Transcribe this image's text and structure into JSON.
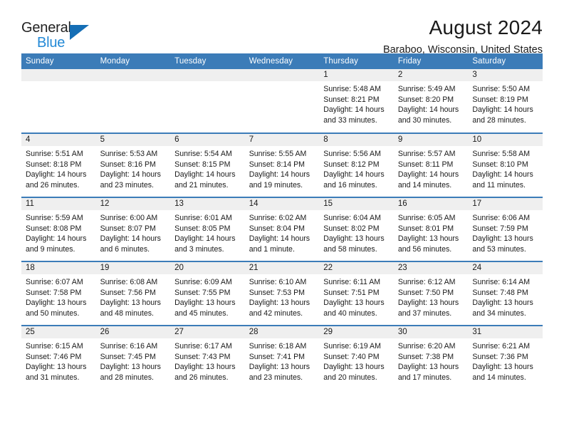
{
  "brand": {
    "name_part1": "General",
    "name_part2": "Blue",
    "triangle_color": "#156eb5",
    "blue_text_color": "#2389d6"
  },
  "header": {
    "month_title": "August 2024",
    "location": "Baraboo, Wisconsin, United States"
  },
  "theme": {
    "header_blue": "#3c7cb8",
    "daynum_band_gray": "#efefef",
    "text_color": "#1a1a1a"
  },
  "calendar": {
    "weekday_headers": [
      "Sunday",
      "Monday",
      "Tuesday",
      "Wednesday",
      "Thursday",
      "Friday",
      "Saturday"
    ],
    "weeks": [
      [
        {
          "day": "",
          "lines": []
        },
        {
          "day": "",
          "lines": []
        },
        {
          "day": "",
          "lines": []
        },
        {
          "day": "",
          "lines": []
        },
        {
          "day": "1",
          "lines": [
            "Sunrise: 5:48 AM",
            "Sunset: 8:21 PM",
            "Daylight: 14 hours and 33 minutes."
          ]
        },
        {
          "day": "2",
          "lines": [
            "Sunrise: 5:49 AM",
            "Sunset: 8:20 PM",
            "Daylight: 14 hours and 30 minutes."
          ]
        },
        {
          "day": "3",
          "lines": [
            "Sunrise: 5:50 AM",
            "Sunset: 8:19 PM",
            "Daylight: 14 hours and 28 minutes."
          ]
        }
      ],
      [
        {
          "day": "4",
          "lines": [
            "Sunrise: 5:51 AM",
            "Sunset: 8:18 PM",
            "Daylight: 14 hours and 26 minutes."
          ]
        },
        {
          "day": "5",
          "lines": [
            "Sunrise: 5:53 AM",
            "Sunset: 8:16 PM",
            "Daylight: 14 hours and 23 minutes."
          ]
        },
        {
          "day": "6",
          "lines": [
            "Sunrise: 5:54 AM",
            "Sunset: 8:15 PM",
            "Daylight: 14 hours and 21 minutes."
          ]
        },
        {
          "day": "7",
          "lines": [
            "Sunrise: 5:55 AM",
            "Sunset: 8:14 PM",
            "Daylight: 14 hours and 19 minutes."
          ]
        },
        {
          "day": "8",
          "lines": [
            "Sunrise: 5:56 AM",
            "Sunset: 8:12 PM",
            "Daylight: 14 hours and 16 minutes."
          ]
        },
        {
          "day": "9",
          "lines": [
            "Sunrise: 5:57 AM",
            "Sunset: 8:11 PM",
            "Daylight: 14 hours and 14 minutes."
          ]
        },
        {
          "day": "10",
          "lines": [
            "Sunrise: 5:58 AM",
            "Sunset: 8:10 PM",
            "Daylight: 14 hours and 11 minutes."
          ]
        }
      ],
      [
        {
          "day": "11",
          "lines": [
            "Sunrise: 5:59 AM",
            "Sunset: 8:08 PM",
            "Daylight: 14 hours and 9 minutes."
          ]
        },
        {
          "day": "12",
          "lines": [
            "Sunrise: 6:00 AM",
            "Sunset: 8:07 PM",
            "Daylight: 14 hours and 6 minutes."
          ]
        },
        {
          "day": "13",
          "lines": [
            "Sunrise: 6:01 AM",
            "Sunset: 8:05 PM",
            "Daylight: 14 hours and 3 minutes."
          ]
        },
        {
          "day": "14",
          "lines": [
            "Sunrise: 6:02 AM",
            "Sunset: 8:04 PM",
            "Daylight: 14 hours and 1 minute."
          ]
        },
        {
          "day": "15",
          "lines": [
            "Sunrise: 6:04 AM",
            "Sunset: 8:02 PM",
            "Daylight: 13 hours and 58 minutes."
          ]
        },
        {
          "day": "16",
          "lines": [
            "Sunrise: 6:05 AM",
            "Sunset: 8:01 PM",
            "Daylight: 13 hours and 56 minutes."
          ]
        },
        {
          "day": "17",
          "lines": [
            "Sunrise: 6:06 AM",
            "Sunset: 7:59 PM",
            "Daylight: 13 hours and 53 minutes."
          ]
        }
      ],
      [
        {
          "day": "18",
          "lines": [
            "Sunrise: 6:07 AM",
            "Sunset: 7:58 PM",
            "Daylight: 13 hours and 50 minutes."
          ]
        },
        {
          "day": "19",
          "lines": [
            "Sunrise: 6:08 AM",
            "Sunset: 7:56 PM",
            "Daylight: 13 hours and 48 minutes."
          ]
        },
        {
          "day": "20",
          "lines": [
            "Sunrise: 6:09 AM",
            "Sunset: 7:55 PM",
            "Daylight: 13 hours and 45 minutes."
          ]
        },
        {
          "day": "21",
          "lines": [
            "Sunrise: 6:10 AM",
            "Sunset: 7:53 PM",
            "Daylight: 13 hours and 42 minutes."
          ]
        },
        {
          "day": "22",
          "lines": [
            "Sunrise: 6:11 AM",
            "Sunset: 7:51 PM",
            "Daylight: 13 hours and 40 minutes."
          ]
        },
        {
          "day": "23",
          "lines": [
            "Sunrise: 6:12 AM",
            "Sunset: 7:50 PM",
            "Daylight: 13 hours and 37 minutes."
          ]
        },
        {
          "day": "24",
          "lines": [
            "Sunrise: 6:14 AM",
            "Sunset: 7:48 PM",
            "Daylight: 13 hours and 34 minutes."
          ]
        }
      ],
      [
        {
          "day": "25",
          "lines": [
            "Sunrise: 6:15 AM",
            "Sunset: 7:46 PM",
            "Daylight: 13 hours and 31 minutes."
          ]
        },
        {
          "day": "26",
          "lines": [
            "Sunrise: 6:16 AM",
            "Sunset: 7:45 PM",
            "Daylight: 13 hours and 28 minutes."
          ]
        },
        {
          "day": "27",
          "lines": [
            "Sunrise: 6:17 AM",
            "Sunset: 7:43 PM",
            "Daylight: 13 hours and 26 minutes."
          ]
        },
        {
          "day": "28",
          "lines": [
            "Sunrise: 6:18 AM",
            "Sunset: 7:41 PM",
            "Daylight: 13 hours and 23 minutes."
          ]
        },
        {
          "day": "29",
          "lines": [
            "Sunrise: 6:19 AM",
            "Sunset: 7:40 PM",
            "Daylight: 13 hours and 20 minutes."
          ]
        },
        {
          "day": "30",
          "lines": [
            "Sunrise: 6:20 AM",
            "Sunset: 7:38 PM",
            "Daylight: 13 hours and 17 minutes."
          ]
        },
        {
          "day": "31",
          "lines": [
            "Sunrise: 6:21 AM",
            "Sunset: 7:36 PM",
            "Daylight: 13 hours and 14 minutes."
          ]
        }
      ]
    ]
  }
}
